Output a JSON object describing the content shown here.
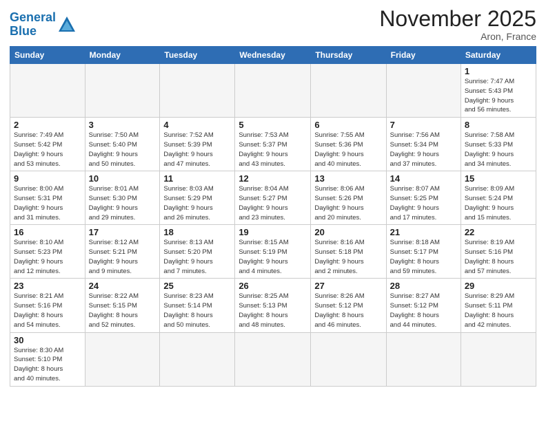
{
  "logo": {
    "text_general": "General",
    "text_blue": "Blue"
  },
  "title": "November 2025",
  "subtitle": "Aron, France",
  "days_of_week": [
    "Sunday",
    "Monday",
    "Tuesday",
    "Wednesday",
    "Thursday",
    "Friday",
    "Saturday"
  ],
  "weeks": [
    [
      {
        "day": "",
        "info": ""
      },
      {
        "day": "",
        "info": ""
      },
      {
        "day": "",
        "info": ""
      },
      {
        "day": "",
        "info": ""
      },
      {
        "day": "",
        "info": ""
      },
      {
        "day": "",
        "info": ""
      },
      {
        "day": "1",
        "info": "Sunrise: 7:47 AM\nSunset: 5:43 PM\nDaylight: 9 hours\nand 56 minutes."
      }
    ],
    [
      {
        "day": "2",
        "info": "Sunrise: 7:49 AM\nSunset: 5:42 PM\nDaylight: 9 hours\nand 53 minutes."
      },
      {
        "day": "3",
        "info": "Sunrise: 7:50 AM\nSunset: 5:40 PM\nDaylight: 9 hours\nand 50 minutes."
      },
      {
        "day": "4",
        "info": "Sunrise: 7:52 AM\nSunset: 5:39 PM\nDaylight: 9 hours\nand 47 minutes."
      },
      {
        "day": "5",
        "info": "Sunrise: 7:53 AM\nSunset: 5:37 PM\nDaylight: 9 hours\nand 43 minutes."
      },
      {
        "day": "6",
        "info": "Sunrise: 7:55 AM\nSunset: 5:36 PM\nDaylight: 9 hours\nand 40 minutes."
      },
      {
        "day": "7",
        "info": "Sunrise: 7:56 AM\nSunset: 5:34 PM\nDaylight: 9 hours\nand 37 minutes."
      },
      {
        "day": "8",
        "info": "Sunrise: 7:58 AM\nSunset: 5:33 PM\nDaylight: 9 hours\nand 34 minutes."
      }
    ],
    [
      {
        "day": "9",
        "info": "Sunrise: 8:00 AM\nSunset: 5:31 PM\nDaylight: 9 hours\nand 31 minutes."
      },
      {
        "day": "10",
        "info": "Sunrise: 8:01 AM\nSunset: 5:30 PM\nDaylight: 9 hours\nand 29 minutes."
      },
      {
        "day": "11",
        "info": "Sunrise: 8:03 AM\nSunset: 5:29 PM\nDaylight: 9 hours\nand 26 minutes."
      },
      {
        "day": "12",
        "info": "Sunrise: 8:04 AM\nSunset: 5:27 PM\nDaylight: 9 hours\nand 23 minutes."
      },
      {
        "day": "13",
        "info": "Sunrise: 8:06 AM\nSunset: 5:26 PM\nDaylight: 9 hours\nand 20 minutes."
      },
      {
        "day": "14",
        "info": "Sunrise: 8:07 AM\nSunset: 5:25 PM\nDaylight: 9 hours\nand 17 minutes."
      },
      {
        "day": "15",
        "info": "Sunrise: 8:09 AM\nSunset: 5:24 PM\nDaylight: 9 hours\nand 15 minutes."
      }
    ],
    [
      {
        "day": "16",
        "info": "Sunrise: 8:10 AM\nSunset: 5:23 PM\nDaylight: 9 hours\nand 12 minutes."
      },
      {
        "day": "17",
        "info": "Sunrise: 8:12 AM\nSunset: 5:21 PM\nDaylight: 9 hours\nand 9 minutes."
      },
      {
        "day": "18",
        "info": "Sunrise: 8:13 AM\nSunset: 5:20 PM\nDaylight: 9 hours\nand 7 minutes."
      },
      {
        "day": "19",
        "info": "Sunrise: 8:15 AM\nSunset: 5:19 PM\nDaylight: 9 hours\nand 4 minutes."
      },
      {
        "day": "20",
        "info": "Sunrise: 8:16 AM\nSunset: 5:18 PM\nDaylight: 9 hours\nand 2 minutes."
      },
      {
        "day": "21",
        "info": "Sunrise: 8:18 AM\nSunset: 5:17 PM\nDaylight: 8 hours\nand 59 minutes."
      },
      {
        "day": "22",
        "info": "Sunrise: 8:19 AM\nSunset: 5:16 PM\nDaylight: 8 hours\nand 57 minutes."
      }
    ],
    [
      {
        "day": "23",
        "info": "Sunrise: 8:21 AM\nSunset: 5:16 PM\nDaylight: 8 hours\nand 54 minutes."
      },
      {
        "day": "24",
        "info": "Sunrise: 8:22 AM\nSunset: 5:15 PM\nDaylight: 8 hours\nand 52 minutes."
      },
      {
        "day": "25",
        "info": "Sunrise: 8:23 AM\nSunset: 5:14 PM\nDaylight: 8 hours\nand 50 minutes."
      },
      {
        "day": "26",
        "info": "Sunrise: 8:25 AM\nSunset: 5:13 PM\nDaylight: 8 hours\nand 48 minutes."
      },
      {
        "day": "27",
        "info": "Sunrise: 8:26 AM\nSunset: 5:12 PM\nDaylight: 8 hours\nand 46 minutes."
      },
      {
        "day": "28",
        "info": "Sunrise: 8:27 AM\nSunset: 5:12 PM\nDaylight: 8 hours\nand 44 minutes."
      },
      {
        "day": "29",
        "info": "Sunrise: 8:29 AM\nSunset: 5:11 PM\nDaylight: 8 hours\nand 42 minutes."
      }
    ],
    [
      {
        "day": "30",
        "info": "Sunrise: 8:30 AM\nSunset: 5:10 PM\nDaylight: 8 hours\nand 40 minutes."
      },
      {
        "day": "",
        "info": ""
      },
      {
        "day": "",
        "info": ""
      },
      {
        "day": "",
        "info": ""
      },
      {
        "day": "",
        "info": ""
      },
      {
        "day": "",
        "info": ""
      },
      {
        "day": "",
        "info": ""
      }
    ]
  ]
}
